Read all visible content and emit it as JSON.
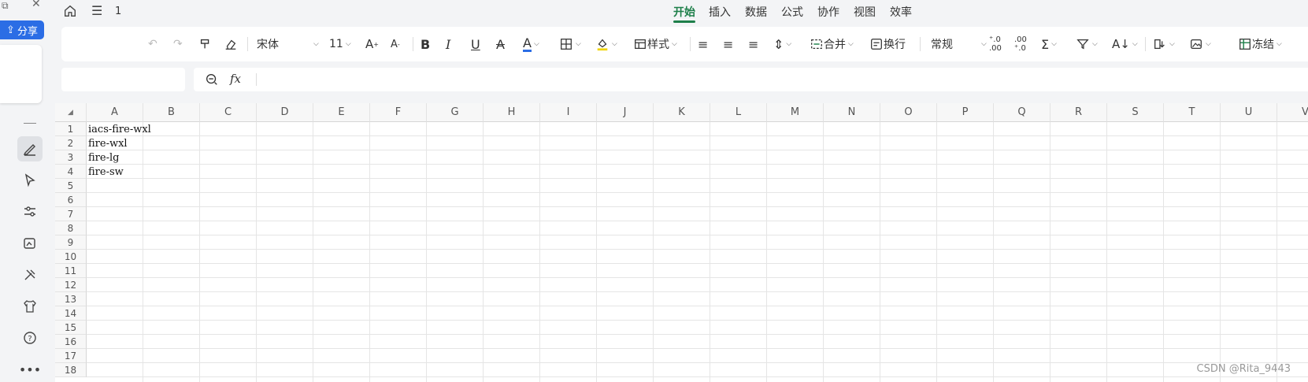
{
  "left": {
    "share_label": "分享"
  },
  "topbar": {
    "sheet_count": "1",
    "tabs": [
      "开始",
      "插入",
      "数据",
      "公式",
      "协作",
      "视图",
      "效率"
    ],
    "active_tab": "开始"
  },
  "toolbar": {
    "font_name": "宋体",
    "font_size": "11",
    "style_label": "样式",
    "merge_label": "合并",
    "wrap_label": "换行",
    "number_format": "常规",
    "freeze_label": "冻结"
  },
  "formula": {
    "fx_label": "fx",
    "namebox_value": "",
    "formula_value": ""
  },
  "grid": {
    "columns": [
      "A",
      "B",
      "C",
      "D",
      "E",
      "F",
      "G",
      "H",
      "I",
      "J",
      "K",
      "L",
      "M",
      "N",
      "O",
      "P",
      "Q",
      "R",
      "S",
      "T",
      "U",
      "V"
    ],
    "rows": [
      "1",
      "2",
      "3",
      "4",
      "5",
      "6",
      "7",
      "8",
      "9",
      "10",
      "11",
      "12",
      "13",
      "14",
      "15",
      "16",
      "17",
      "18"
    ],
    "cells": [
      "iacs-fire-wxl",
      "fire-wxl",
      "fire-lg",
      "fire-sw"
    ]
  },
  "watermark": "CSDN @Rita_9443",
  "colors": {
    "accent_green": "#1e7f4a",
    "share_blue": "#2b6de5"
  }
}
